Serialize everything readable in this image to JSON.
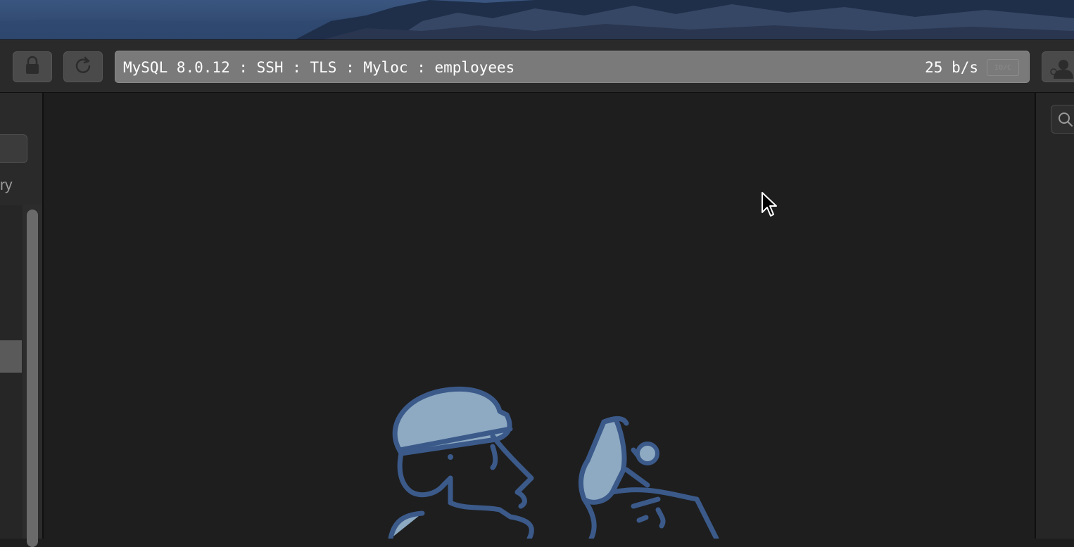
{
  "connection": {
    "address_text": "MySQL 8.0.12 : SSH : TLS : Myloc : employees",
    "throughput": "25 b/s",
    "io_badge": "IO/C"
  },
  "toolbar": {
    "lock_icon": "lock-icon",
    "refresh_icon": "refresh-icon",
    "user_icon": "user-icon"
  },
  "sidebar": {
    "label": "ry"
  },
  "right_panel": {
    "search_icon": "search-icon"
  },
  "colors": {
    "window_bg": "#1e1e1e",
    "toolbar_bg": "#2a2a2a",
    "address_bg": "#7a7a7a",
    "illustration_stroke": "#3b5a8a",
    "illustration_fill": "#8eaac2"
  }
}
